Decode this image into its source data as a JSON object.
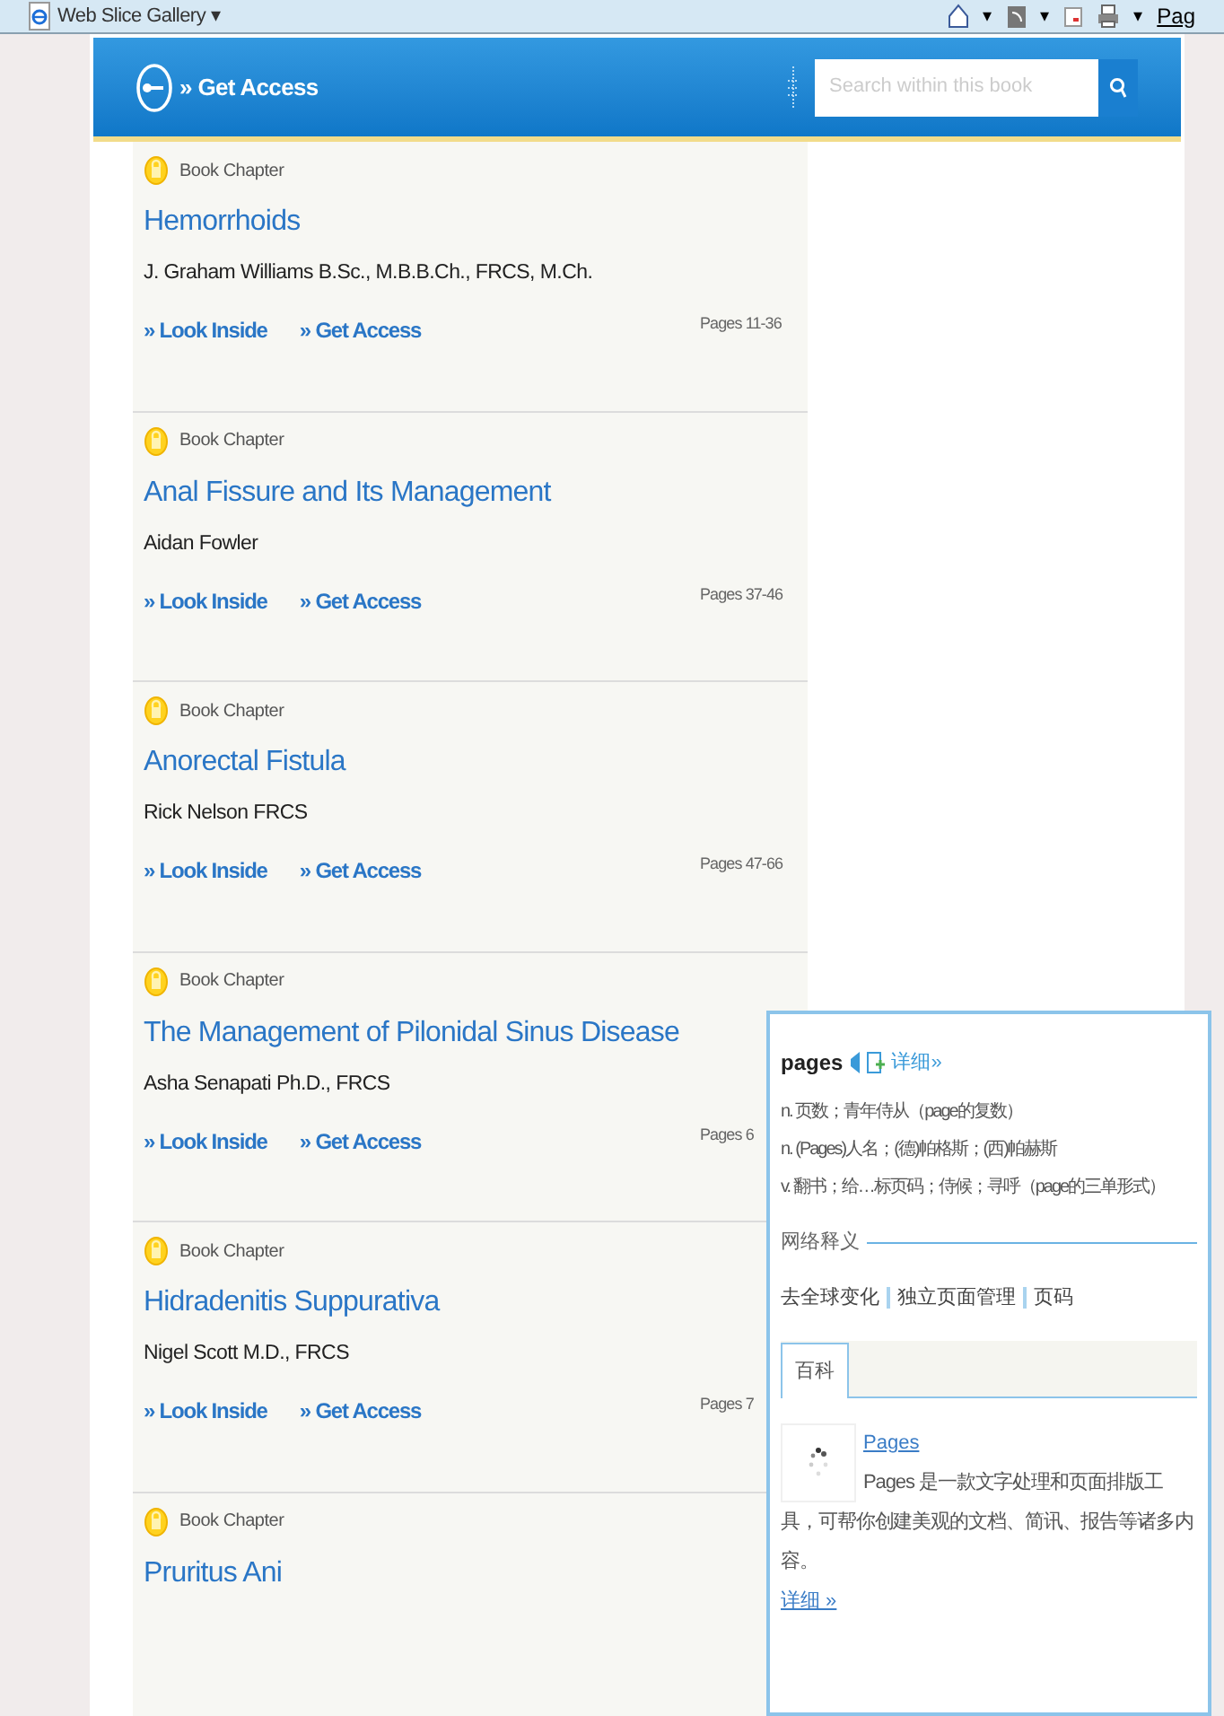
{
  "toolbar": {
    "gallery": "Web Slice Gallery ▾",
    "menu_arrows": [
      "▾",
      "▾",
      "▾"
    ],
    "page_menu": "Pag"
  },
  "header": {
    "get_access": "» Get Access",
    "search": {
      "placeholder": "Search within this book"
    }
  },
  "chapters": [
    {
      "type": "Book Chapter",
      "title": "Hemorrhoids",
      "authors": "J. Graham Williams B.Sc., M.B.B.Ch., FRCS, M.Ch.",
      "links": [
        "» Look Inside",
        "» Get Access"
      ],
      "pages": "Pages 11-36"
    },
    {
      "type": "Book Chapter",
      "title": "Anal Fissure and Its Management",
      "authors": "Aidan Fowler",
      "links": [
        "» Look Inside",
        "» Get Access"
      ],
      "pages": "Pages 37-46"
    },
    {
      "type": "Book Chapter",
      "title": "Anorectal Fistula",
      "authors": "Rick Nelson FRCS",
      "links": [
        "» Look Inside",
        "» Get Access"
      ],
      "pages": "Pages 47-66"
    },
    {
      "type": "Book Chapter",
      "title": "The Management of Pilonidal Sinus Disease",
      "authors": "Asha Senapati Ph.D., FRCS",
      "links": [
        "» Look Inside",
        "» Get Access"
      ],
      "pages": "Pages 6"
    },
    {
      "type": "Book Chapter",
      "title": "Hidradenitis Suppurativa",
      "authors": "Nigel Scott M.D., FRCS",
      "links": [
        "» Look Inside",
        "» Get Access"
      ],
      "pages": "Pages 7"
    },
    {
      "type": "Book Chapter",
      "title": "Pruritus Ani"
    }
  ],
  "dictionary": {
    "word": "pages",
    "detail_link": "详细»",
    "definitions": [
      {
        "pos": "n.",
        "text": "页数；青年侍从（page的复数）"
      },
      {
        "pos": "n.",
        "text": "(Pages)人名；(德)帕格斯；(西)帕赫斯"
      },
      {
        "pos": "v.",
        "text": "翻书；给…标页码；侍候；寻呼（page的三单形式）"
      }
    ],
    "web_heading": "网络释义",
    "web_terms": [
      "去全球变化",
      "独立页面管理",
      "页码"
    ],
    "tabs": [
      {
        "label": "百科",
        "selected": true
      }
    ],
    "wiki": {
      "title": "Pages",
      "text": "Pages 是一款文字处理和页面排版工具，可帮你创建美观的文档、简讯、报告等诸多内容。",
      "more": "详细 »"
    }
  }
}
